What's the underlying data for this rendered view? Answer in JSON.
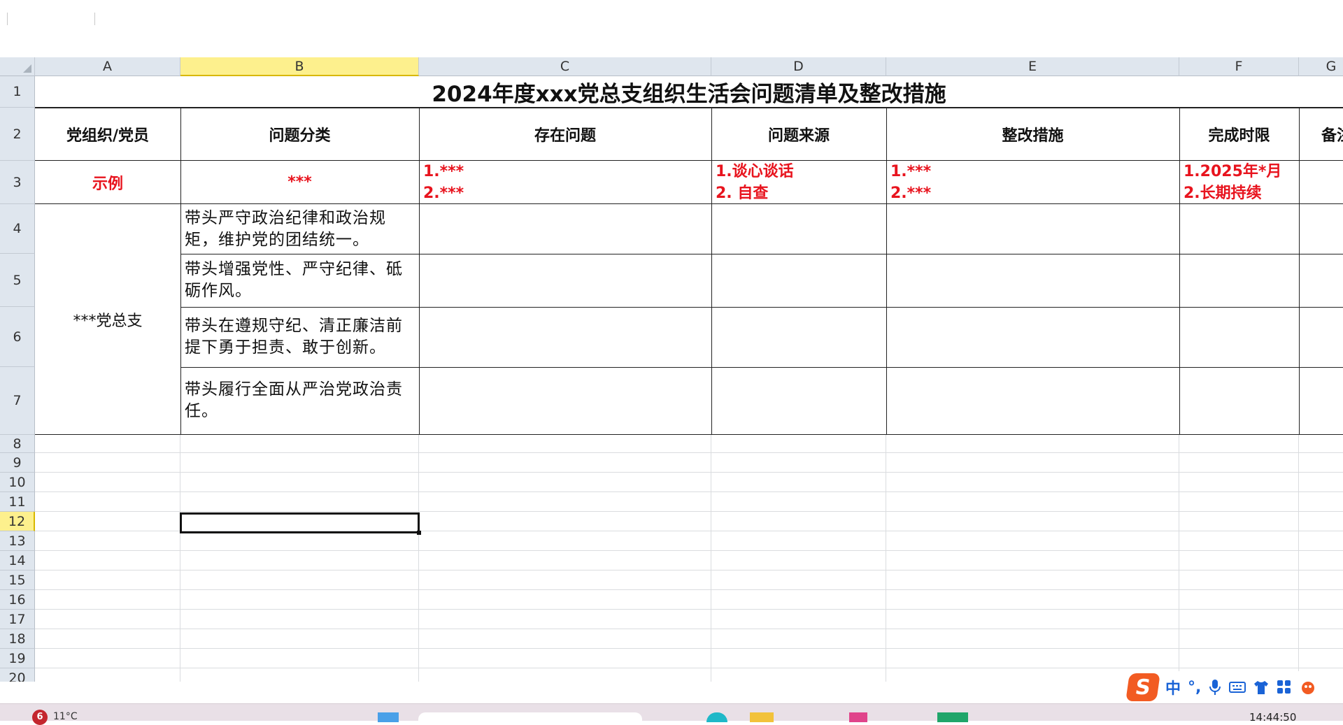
{
  "columns": [
    "A",
    "B",
    "C",
    "D",
    "E",
    "F",
    "G"
  ],
  "rows": [
    "1",
    "2",
    "3",
    "4",
    "5",
    "6",
    "7",
    "8",
    "9",
    "10",
    "11",
    "12",
    "13",
    "14",
    "15",
    "16",
    "17",
    "18",
    "19",
    "20"
  ],
  "selected_cell": {
    "column": "B",
    "row": "12"
  },
  "sheet": {
    "title": "2024年度xxx党总支组织生活会问题清单及整改措施",
    "headers": [
      "党组织/党员",
      "问题分类",
      "存在问题",
      "问题来源",
      "整改措施",
      "完成时限",
      "备注"
    ],
    "example": {
      "org": "示例",
      "category": "***",
      "issues": [
        "1.***",
        "2.***"
      ],
      "sources": [
        "1.谈心谈话",
        "2. 自查"
      ],
      "measures": [
        "1.***",
        "2.***"
      ],
      "deadlines": [
        "1.2025年*月",
        "2.长期持续"
      ]
    },
    "org_name": "***党总支",
    "categories": [
      "带头严守政治纪律和政治规矩，维护党的团结统一。",
      "带头增强党性、严守纪律、砥砺作风。",
      "带头在遵规守纪、清正廉洁前提下勇于担责、敢于创新。",
      "带头履行全面从严治党政治责任。"
    ]
  },
  "ime": {
    "logo": "S",
    "lang": "中",
    "punct": "°,"
  },
  "taskbar": {
    "notification_count": "6",
    "weather": "11°C",
    "time": "14:44:50"
  }
}
